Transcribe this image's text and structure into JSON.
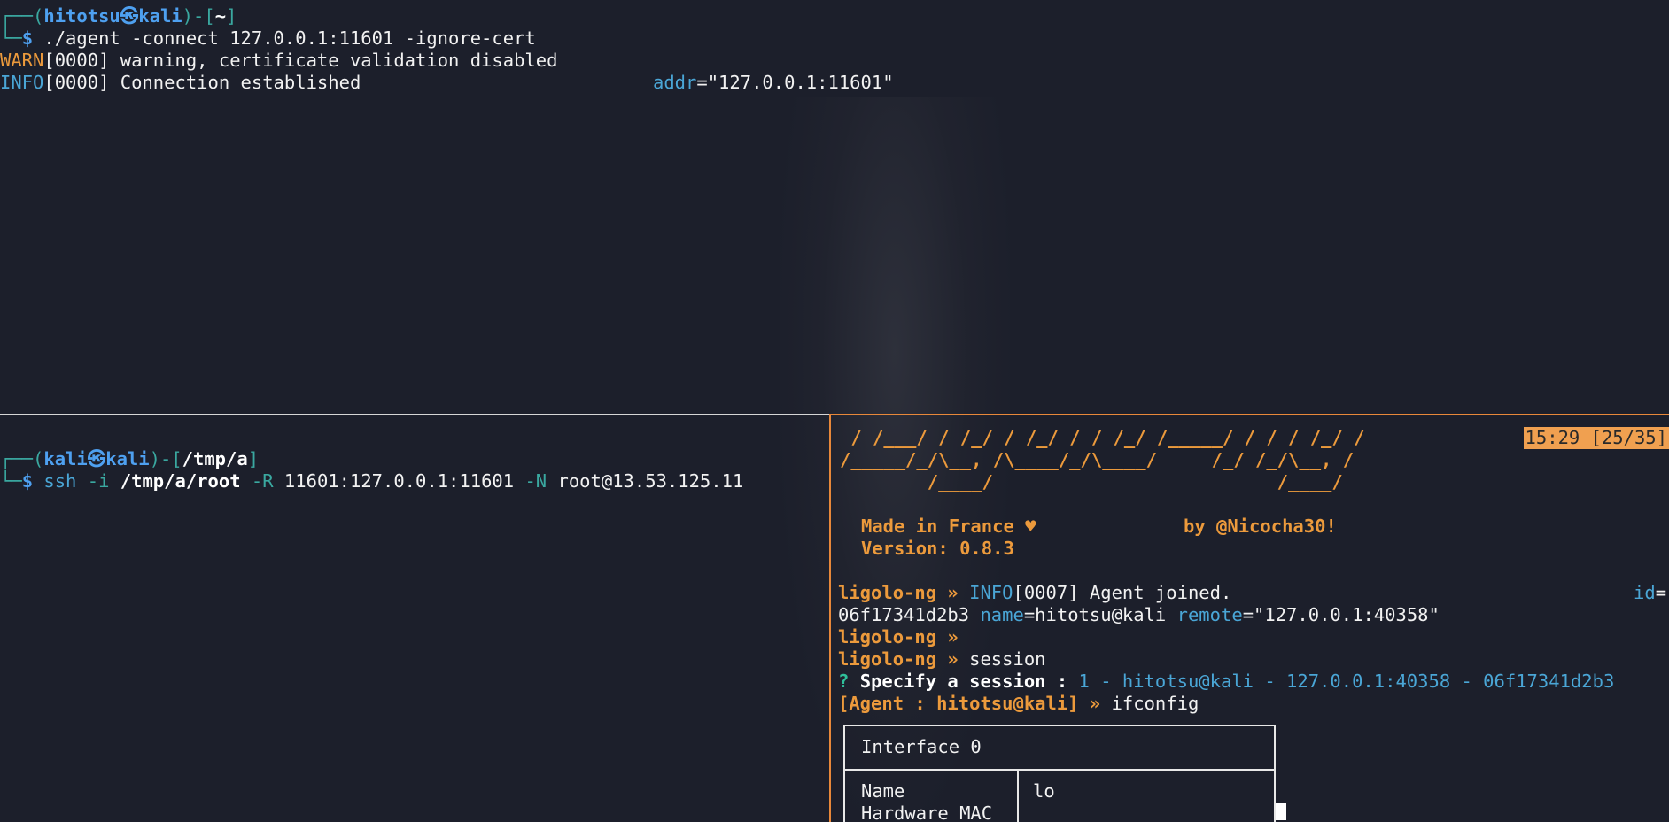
{
  "top_pane": {
    "prompt": {
      "box_open": "┌──(",
      "user": "hitotsu",
      "at": "㉿",
      "host": "kali",
      "mid": ")-[",
      "dir": "~",
      "close": "]",
      "cont": "└─",
      "sym": "$"
    },
    "command": " ./agent -connect 127.0.0.1:11601 -ignore-cert",
    "log1": {
      "level": "WARN",
      "rest": "[0000] warning, certificate validation disabled"
    },
    "log2": {
      "level": "INFO",
      "rest": "[0000] Connection established",
      "key": "addr",
      "value": "=\"127.0.0.1:11601\""
    }
  },
  "bottom_left_pane": {
    "prompt": {
      "box_open": "┌──(",
      "user": "kali",
      "at": "㉿",
      "host": "kali",
      "mid": ")-[",
      "dir": "/tmp/a",
      "close": "]",
      "cont": "└─",
      "sym": "$"
    },
    "cmd": {
      "ssh": "ssh",
      "flag_i": "-i",
      "keyfile": "/tmp/a/root",
      "flag_r": "-R",
      "forward": "11601:127.0.0.1:11601",
      "flag_n": "-N",
      "target": "root@13.53.125.11"
    }
  },
  "bottom_right_pane": {
    "status_bar": "15:29 [25/35]",
    "banner": [
      " / /___/ / /_/ / /_/ / / /_/ /_____/ / / / /_/ /",
      "/_____/_/\\__, /\\____/_/\\____/     /_/ /_/\\__, /",
      "        /____/                          /____/"
    ],
    "made_in": "Made in France ♥",
    "by": "by @Nicocha30!",
    "version": "Version: 0.8.3",
    "prompt_label": "ligolo-ng »",
    "agent_line": {
      "level": "INFO",
      "rest": "[0007] Agent joined.",
      "id_key": "id",
      "id_eq": "=",
      "id_val": "06f17341d2b3",
      "name_key": "name",
      "name_val": "=hitotsu@kali",
      "remote_key": "remote",
      "remote_val": "=\"127.0.0.1:40358\""
    },
    "session_cmd": "session",
    "specify": {
      "q": "?",
      "label": "Specify a session :",
      "value": "1 - hitotsu@kali - 127.0.0.1:40358 - 06f17341d2b3"
    },
    "agent_prompt": "[Agent : hitotsu@kali] »",
    "ifconfig_cmd": "ifconfig",
    "table": {
      "header": "Interface 0",
      "row1_key": "Name",
      "row1_val": "lo",
      "row2_key": "Hardware MAC"
    }
  }
}
